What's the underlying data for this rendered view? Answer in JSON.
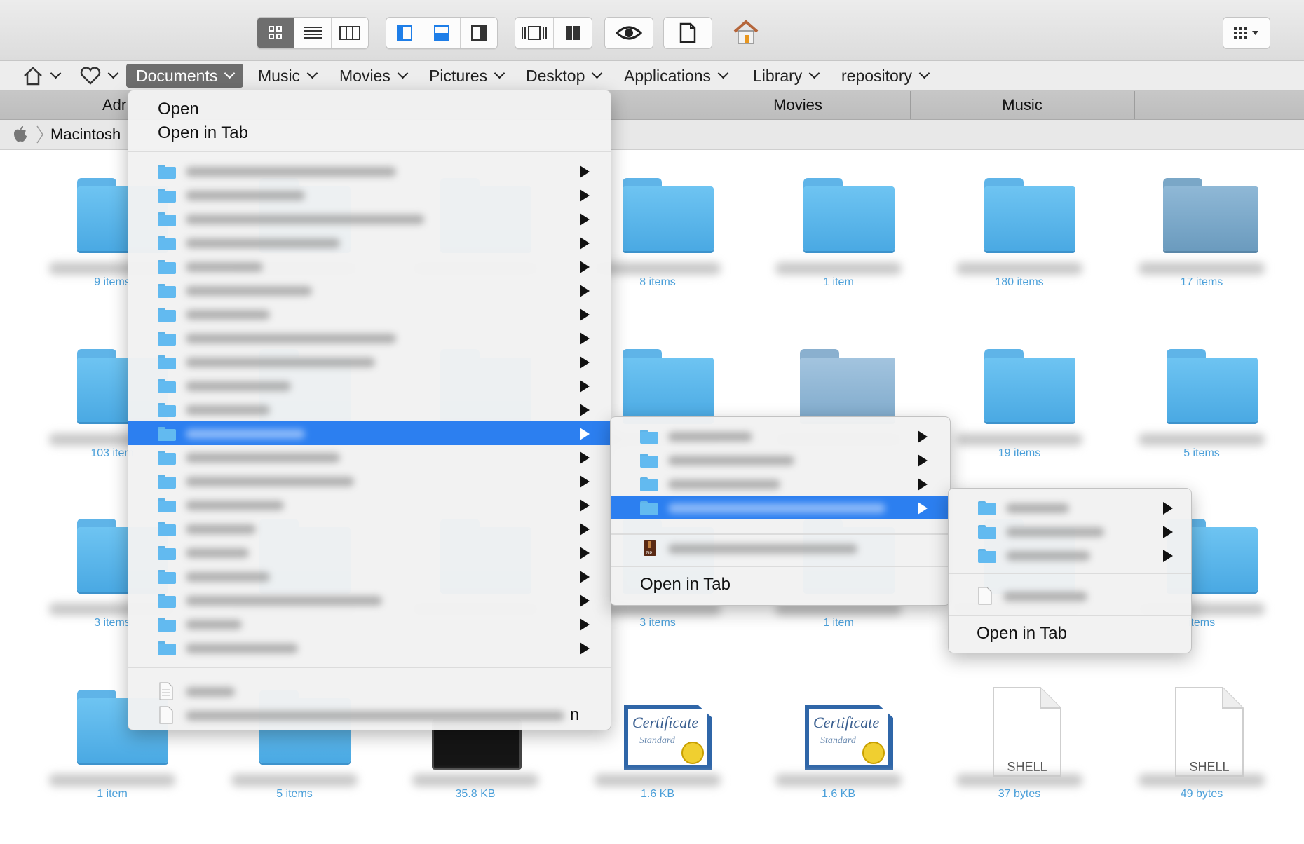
{
  "toolbar": {
    "view_buttons": [
      "icon-view-icon",
      "list-view-icon",
      "column-view-icon"
    ],
    "pane_buttons": [
      "left-pane-icon",
      "bottom-pane-icon",
      "right-pane-icon"
    ],
    "extra_buttons": [
      "coverflow-icon",
      "dual-pane-icon"
    ],
    "single_buttons": [
      "quick-look-icon",
      "new-file-icon",
      "home-icon"
    ],
    "right_button": "arrange-grid-icon"
  },
  "favorites": {
    "items": [
      {
        "label": "",
        "icon": "home-icon"
      },
      {
        "label": "",
        "icon": "heart-icon"
      },
      {
        "label": "Documents"
      },
      {
        "label": "Music"
      },
      {
        "label": "Movies"
      },
      {
        "label": "Pictures"
      },
      {
        "label": "Desktop"
      },
      {
        "label": "Applications"
      },
      {
        "label": "Library"
      },
      {
        "label": "repository"
      }
    ]
  },
  "tabs": [
    "Adr",
    "Movies",
    "Music"
  ],
  "path": {
    "label": "Macintosh"
  },
  "grid": {
    "rows": [
      [
        {
          "sub": "9 items"
        },
        {
          "sub": ""
        },
        {
          "sub": ""
        },
        {
          "sub": "8 items"
        },
        {
          "sub": "1 item"
        },
        {
          "sub": "180 items"
        },
        {
          "sub": "17 items"
        }
      ],
      [
        {
          "sub": "103 item"
        },
        {
          "sub": ""
        },
        {
          "sub": ""
        },
        {
          "sub": ""
        },
        {
          "sub": ""
        },
        {
          "sub": "19 items"
        },
        {
          "sub": "5 items"
        }
      ],
      [
        {
          "sub": "3 items"
        },
        {
          "sub": ""
        },
        {
          "sub": ""
        },
        {
          "sub": "3 items"
        },
        {
          "sub": "1 item"
        },
        {
          "sub": ""
        },
        {
          "sub": "items"
        }
      ],
      [
        {
          "sub": "1 item"
        },
        {
          "sub": "5 items"
        },
        {
          "sub": "35.8 KB"
        },
        {
          "sub": "1.6 KB"
        },
        {
          "sub": "1.6 KB"
        },
        {
          "sub": "37 bytes"
        },
        {
          "sub": "49 bytes"
        }
      ]
    ],
    "shell_label": "SHELL"
  },
  "menu1": {
    "open": "Open",
    "open_in_tab": "Open in Tab",
    "trailing_char": "n"
  },
  "menu2": {
    "open_in_tab": "Open in Tab"
  },
  "menu3": {
    "open_in_tab": "Open in Tab"
  },
  "colors": {
    "accent": "#2c7ff0",
    "folder": "#62baf0",
    "subtext": "#4a9fd9"
  }
}
